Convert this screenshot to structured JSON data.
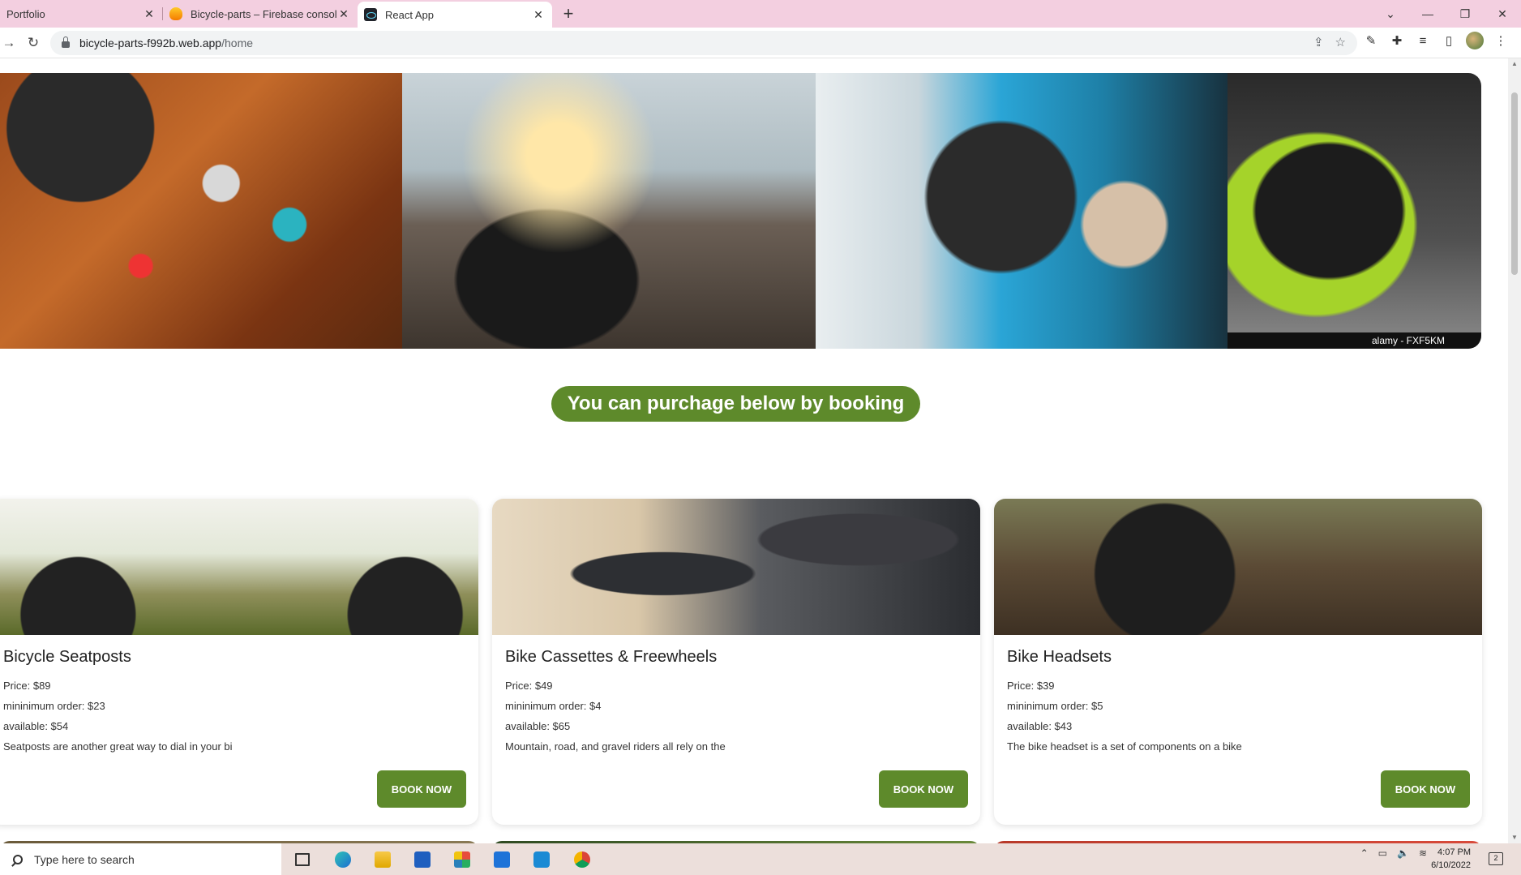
{
  "browser": {
    "tabs": [
      {
        "title": "Portfolio"
      },
      {
        "title": "Bicycle-parts – Firebase console"
      },
      {
        "title": "React App"
      }
    ],
    "new_tab_icon": "plus-icon",
    "url_host": "bicycle-parts-f992b.web.app",
    "url_path": "/home"
  },
  "hero": {
    "images": [
      "bike-tools",
      "cyclist-sunset",
      "bike-repair-closeup",
      "chain-closeup"
    ],
    "watermark": "alamy - FXF5KM"
  },
  "cta": {
    "text": "You can purchage below by booking",
    "color": "#5e8a2b"
  },
  "products": [
    {
      "name": "Bicycle Seatposts",
      "price": "Price: $89",
      "min_order": "mininimum order: $23",
      "available": "available: $54",
      "description": "Seatposts are another great way to dial in your bi",
      "button": "BOOK NOW"
    },
    {
      "name": "Bike Cassettes & Freewheels",
      "price": "Price: $49",
      "min_order": "mininimum order: $4",
      "available": "available: $65",
      "description": "Mountain, road, and gravel riders all rely on the",
      "button": "BOOK NOW"
    },
    {
      "name": "Bike Headsets",
      "price": "Price: $39",
      "min_order": "mininimum order: $5",
      "available": "available: $43",
      "description": "The bike headset is a set of components on a bike",
      "button": "BOOK NOW"
    }
  ],
  "taskbar": {
    "search_placeholder": "Type here to search",
    "time": "4:07 PM",
    "date": "6/10/2022",
    "notification_count": "2"
  }
}
